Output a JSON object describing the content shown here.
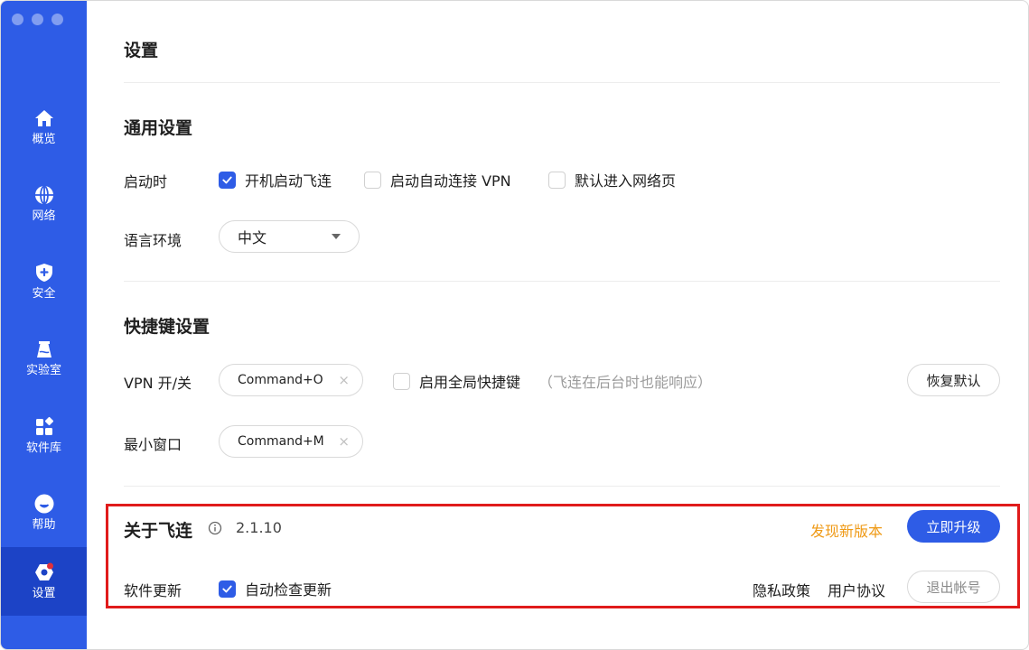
{
  "colors": {
    "sidebar": "#2e5ce6",
    "sidebar_active": "#1c43c6",
    "accent": "#2e5ce6",
    "warning": "#ef9a16",
    "highlight": "#e01b1b"
  },
  "sidebar": {
    "items": [
      {
        "label": "概览",
        "icon": "home-icon"
      },
      {
        "label": "网络",
        "icon": "globe-icon"
      },
      {
        "label": "安全",
        "icon": "shield-icon"
      },
      {
        "label": "实验室",
        "icon": "flask-icon"
      },
      {
        "label": "软件库",
        "icon": "apps-icon"
      },
      {
        "label": "帮助",
        "icon": "help-icon"
      },
      {
        "label": "设置",
        "icon": "settings-icon",
        "active": true
      }
    ]
  },
  "page": {
    "title": "设置"
  },
  "general": {
    "title": "通用设置",
    "startup_label": "启动时",
    "startup_options": [
      {
        "label": "开机启动飞连",
        "checked": true
      },
      {
        "label": "启动自动连接 VPN",
        "checked": false
      },
      {
        "label": "默认进入网络页",
        "checked": false
      }
    ],
    "language_label": "语言环境",
    "language_value": "中文"
  },
  "shortcuts": {
    "title": "快捷键设置",
    "vpn_label": "VPN 开/关",
    "vpn_key": "Command+O",
    "global_label": "启用全局快捷键",
    "global_checked": false,
    "global_hint": "（飞连在后台时也能响应）",
    "restore_label": "恢复默认",
    "minimize_label": "最小窗口",
    "minimize_key": "Command+M",
    "clear_symbol": "×"
  },
  "about": {
    "title": "关于飞连",
    "version": "2.1.10",
    "new_version": "发现新版本",
    "upgrade_label": "立即升级",
    "update_label": "软件更新",
    "auto_check_label": "自动检查更新",
    "auto_check_checked": true,
    "privacy_label": "隐私政策",
    "terms_label": "用户协议",
    "logout_label": "退出帐号"
  }
}
